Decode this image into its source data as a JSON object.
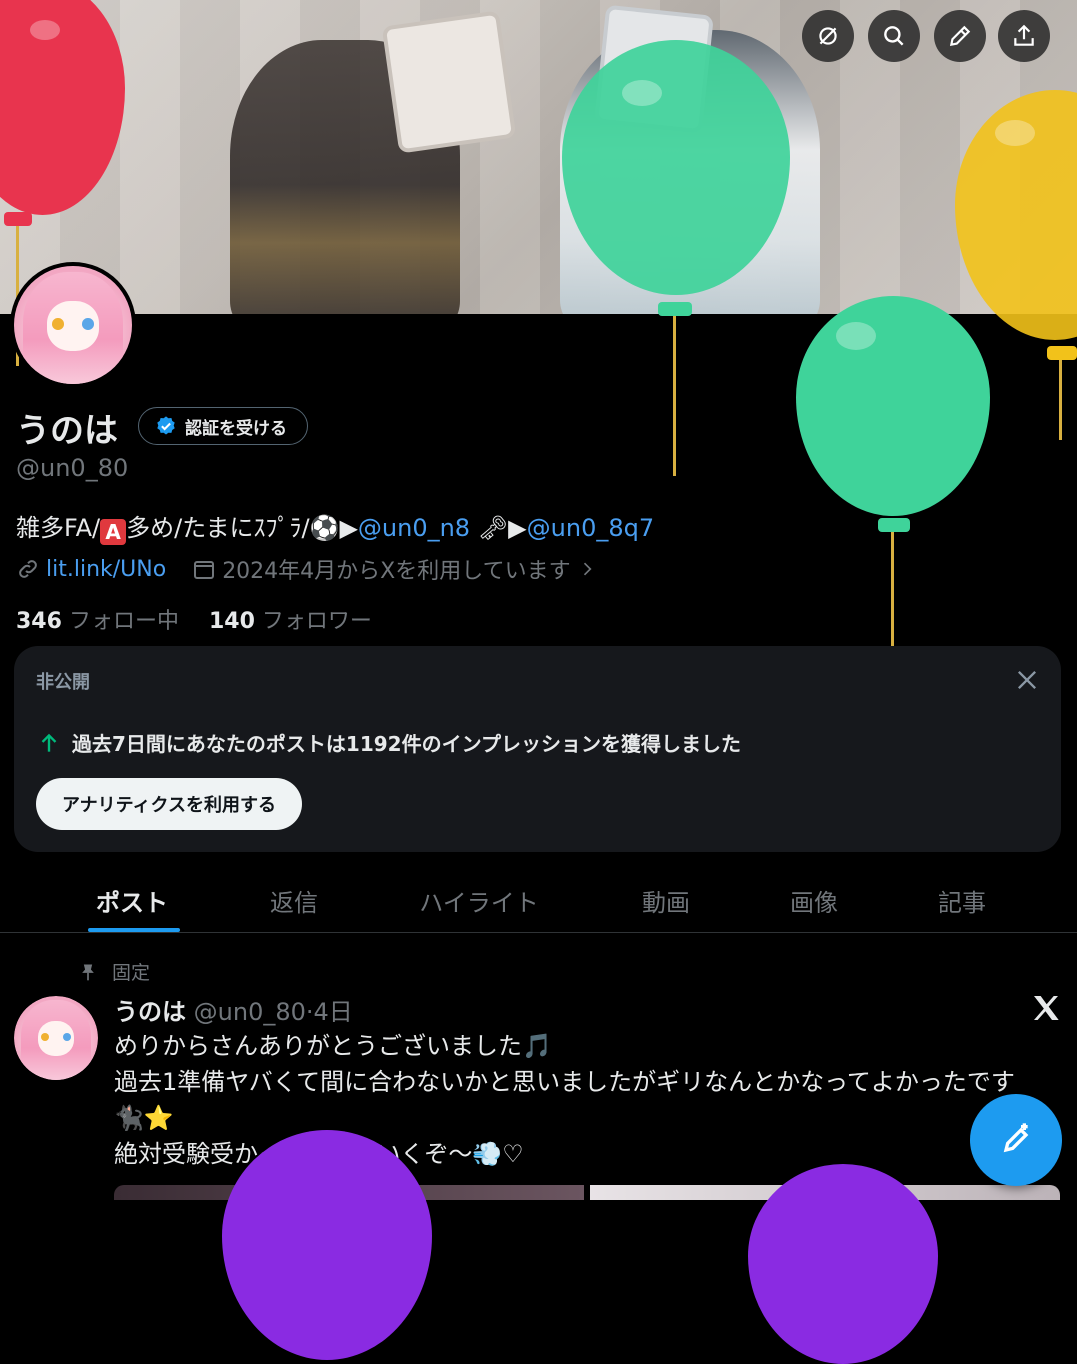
{
  "profile": {
    "name": "うのは",
    "verify_label": "認証を受ける",
    "handle": "@un0_80",
    "bio_prefix": "雑多FA/",
    "bio_a": "A",
    "bio_middle": "多め/たまにｽﾌﾟﾗ/⚽▶",
    "bio_mention1": "@un0_n8",
    "bio_key": " 🗝▶",
    "bio_mention2": "@un0_8q7",
    "link": "lit.link/UNo",
    "joined": "2024年4月からXを利用しています",
    "following_count": "346",
    "following_label": "フォロー中",
    "followers_count": "140",
    "followers_label": "フォロワー"
  },
  "card": {
    "title": "非公開",
    "message": "過去7日間にあなたのポストは1192件のインプレッションを獲得しました",
    "button": "アナリティクスを利用する"
  },
  "tabs": [
    "ポスト",
    "返信",
    "ハイライト",
    "動画",
    "画像",
    "記事"
  ],
  "post": {
    "pinned_label": "固定",
    "author": "うのは",
    "meta": "@un0_80·4日",
    "body": "めりからさんありがとうございました🎵\n過去1準備ヤバくて間に合わないかと思いましたがギリなんとかなってよかったです🐈‍⬛⭐\n絶対受験受かって来年もいくぞ〜💨♡"
  },
  "icons": {
    "back": "back-arrow-icon",
    "hide": "eye-off-icon",
    "search": "search-icon",
    "edit": "pencil-icon",
    "share": "share-icon",
    "verified": "verified-badge-icon",
    "link": "link-icon",
    "calendar": "calendar-icon",
    "chevron": "chevron-right-icon",
    "close": "close-icon",
    "trend_up": "arrow-up-icon",
    "pin": "pin-icon",
    "x_logo": "x-logo-icon",
    "compose": "compose-icon"
  },
  "colors": {
    "accent": "#1d9bf0",
    "mention": "#4a9ef0",
    "muted": "#71767b",
    "card_bg": "#16181c",
    "balloon_red": "#e8344e",
    "balloon_green": "#3fd39a",
    "balloon_yellow": "#f2c21a",
    "balloon_purple": "#8a2be2"
  }
}
